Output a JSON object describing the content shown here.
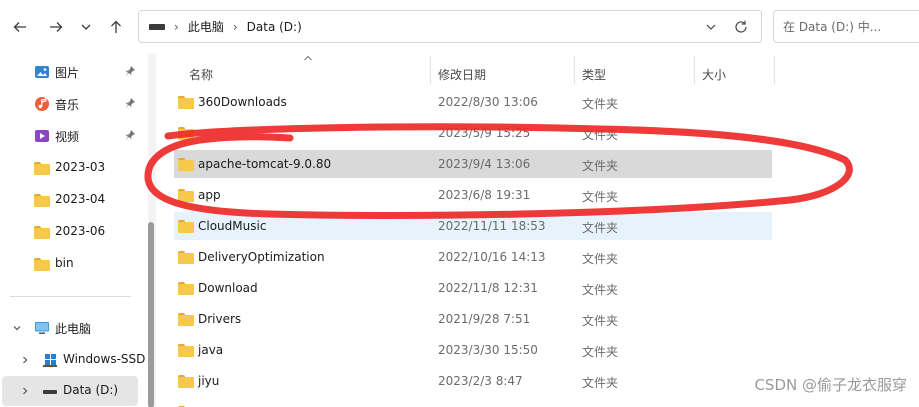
{
  "toolbar": {
    "back_icon": "arrow-left-icon",
    "forward_icon": "arrow-right-icon",
    "history_icon": "chevron-down-icon",
    "up_icon": "arrow-up-icon"
  },
  "address": {
    "crumbs": [
      "此电脑",
      "Data (D:)"
    ],
    "dropdown_icon": "chevron-down-icon",
    "refresh_icon": "refresh-icon"
  },
  "search": {
    "placeholder": "在 Data (D:) 中..."
  },
  "sidebar": {
    "quick": [
      {
        "label": "图片",
        "icon": "pictures-icon",
        "pinned": true
      },
      {
        "label": "音乐",
        "icon": "music-icon",
        "pinned": true
      },
      {
        "label": "视频",
        "icon": "video-icon",
        "pinned": true
      },
      {
        "label": "2023-03",
        "icon": "folder-icon",
        "pinned": false
      },
      {
        "label": "2023-04",
        "icon": "folder-icon",
        "pinned": false
      },
      {
        "label": "2023-06",
        "icon": "folder-icon",
        "pinned": false
      },
      {
        "label": "bin",
        "icon": "folder-icon",
        "pinned": false
      }
    ],
    "this_pc": "此电脑",
    "drives": [
      {
        "label": "Windows-SSD",
        "icon": "windows-drive-icon"
      },
      {
        "label": "Data (D:)",
        "icon": "drive-icon",
        "selected": true
      }
    ]
  },
  "columns": {
    "name": "名称",
    "date": "修改日期",
    "type": "类型",
    "size": "大小"
  },
  "files": [
    {
      "name": "360Downloads",
      "date": "2022/8/30 13:06",
      "type": "文件夹"
    },
    {
      "name": "",
      "date": "2023/5/9 15:25",
      "type": "文件夹"
    },
    {
      "name": "apache-tomcat-9.0.80",
      "date": "2023/9/4 13:06",
      "type": "文件夹"
    },
    {
      "name": "app",
      "date": "2023/6/8 19:31",
      "type": "文件夹"
    },
    {
      "name": "CloudMusic",
      "date": "2022/11/11 18:53",
      "type": "文件夹"
    },
    {
      "name": "DeliveryOptimization",
      "date": "2022/10/16 14:13",
      "type": "文件夹"
    },
    {
      "name": "Download",
      "date": "2022/11/8 12:31",
      "type": "文件夹"
    },
    {
      "name": "Drivers",
      "date": "2021/9/28 7:51",
      "type": "文件夹"
    },
    {
      "name": "java",
      "date": "2023/3/30 15:50",
      "type": "文件夹"
    },
    {
      "name": "jiyu",
      "date": "2023/2/3 8:47",
      "type": "文件夹"
    }
  ],
  "watermark": "CSDN @偷子龙衣服穿",
  "colors": {
    "accent_selected": "#e7f2fc",
    "hover": "#d9d9d9",
    "annotation": "#ee2b2b",
    "folder": "#f7c94a"
  }
}
